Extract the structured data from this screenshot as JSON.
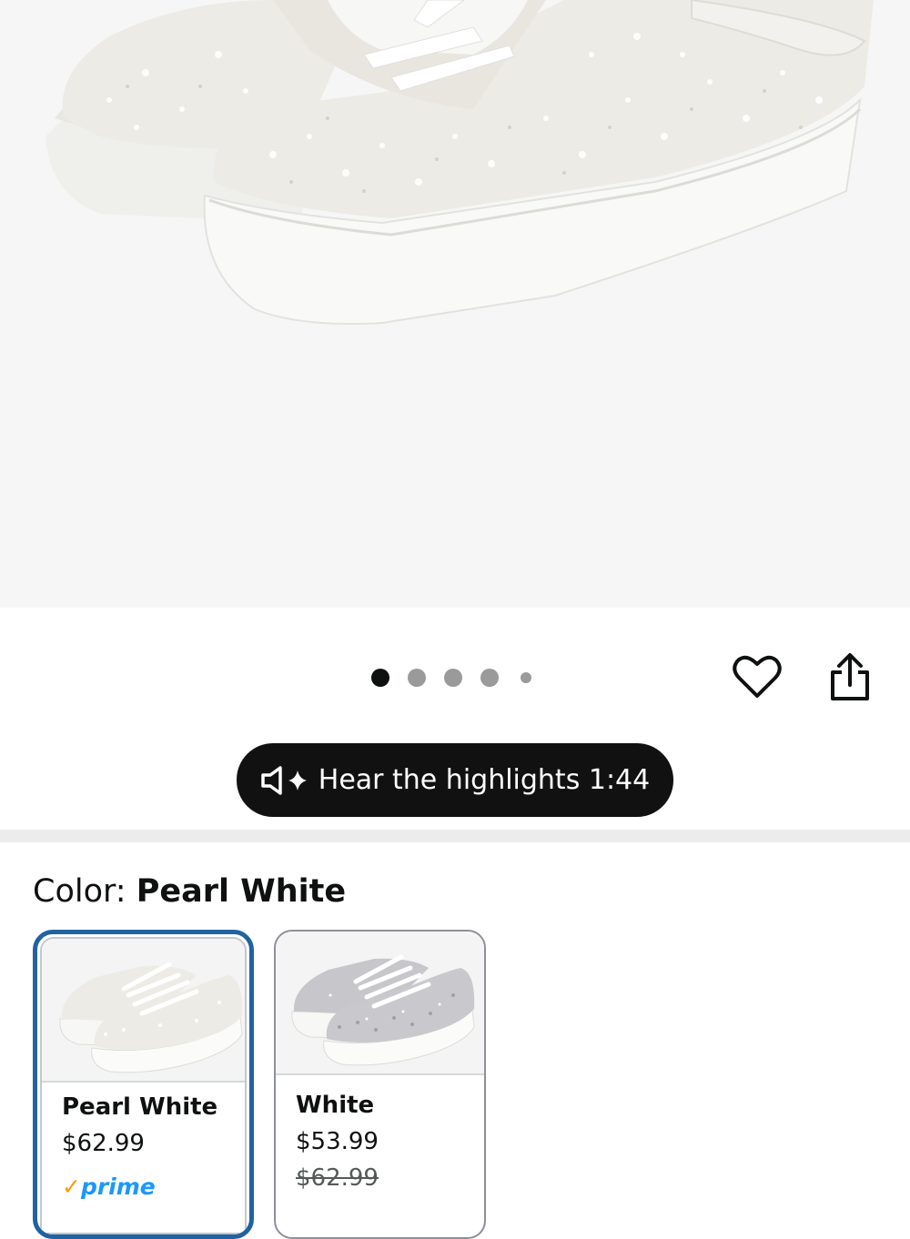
{
  "gallery": {
    "image_alt": "Pearl White rhinestone platform sneakers",
    "dots_total": 5,
    "dots_active_index": 0
  },
  "actions": {
    "favorite_icon": "heart-outline-icon",
    "share_icon": "share-icon"
  },
  "highlights": {
    "label": "Hear the highlights 1:44",
    "icon": "speaker-sparkle-icon"
  },
  "color": {
    "prefix": "Color: ",
    "selected": "Pearl White"
  },
  "swatches": [
    {
      "name": "Pearl White",
      "price": "$62.99",
      "badge": "prime",
      "selected": true
    },
    {
      "name": "White",
      "price": "$53.99",
      "list_price": "$62.99",
      "selected": false
    }
  ],
  "colors": {
    "accent_border": "#2162a1",
    "prime_blue": "#1a98ff",
    "prime_check": "#ff9900"
  }
}
